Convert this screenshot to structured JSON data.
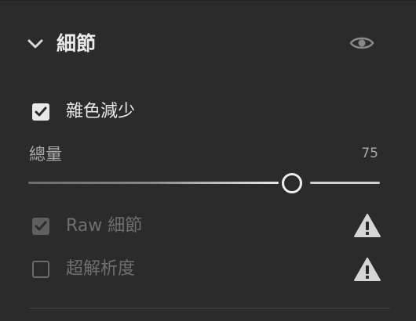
{
  "section": {
    "title": "細節",
    "expanded": true,
    "visibility_icon": "eye-icon"
  },
  "noise_reduction": {
    "label": "雜色減少",
    "checked": true,
    "amount_label": "總量",
    "amount_value": "75",
    "amount_fraction": 0.75
  },
  "raw_details": {
    "label": "Raw 細節",
    "checked": true,
    "enabled": false,
    "warning_icon": "warning-icon"
  },
  "super_resolution": {
    "label": "超解析度",
    "checked": false,
    "enabled": false,
    "warning_icon": "warning-icon"
  },
  "colors": {
    "background": "#2b2b2b",
    "text": "#e6e6e6",
    "dim_text": "#707070",
    "accent": "#ededed"
  }
}
